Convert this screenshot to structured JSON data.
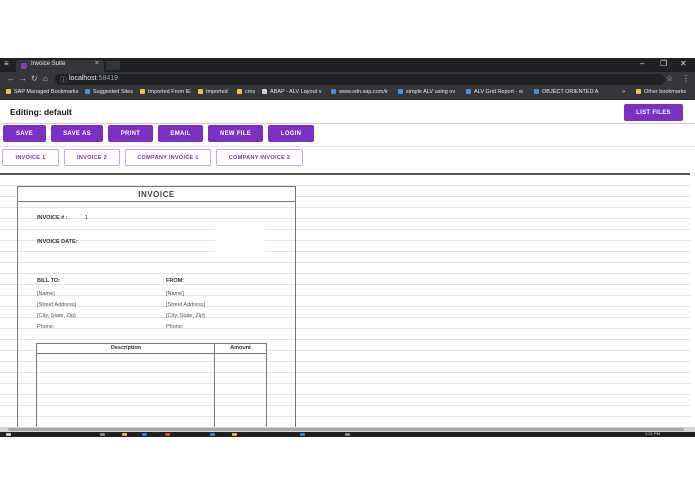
{
  "browser": {
    "tab_title": "Invoice Suite",
    "tab_close": "×",
    "url_host": "localhost",
    "url_port": ":58419",
    "bookmarks": [
      {
        "label": "SAP Managed Bookmarks",
        "color": "#f0c04a"
      },
      {
        "label": "Suggested Sites",
        "color": "#4a90d9"
      },
      {
        "label": "Imported From IE",
        "color": "#f0c04a"
      },
      {
        "label": "Imported",
        "color": "#f0c04a"
      },
      {
        "label": "cms",
        "color": "#f0c04a"
      },
      {
        "label": "ABAP - ALV Layout v",
        "color": "#cfcfcf"
      },
      {
        "label": "www.sdn.sap.com/ir",
        "color": "#4a90d9"
      },
      {
        "label": "simple ALV using ov",
        "color": "#4a90d9"
      },
      {
        "label": "ALV Grid Report - w",
        "color": "#4a90d9"
      },
      {
        "label": "OBJECT ORIENTED A",
        "color": "#4a90d9"
      }
    ],
    "bookmarks_overflow": "»",
    "other_bookmarks": "Other bookmarks"
  },
  "app": {
    "editing_title": "Editing: default",
    "list_files_label": "LIST FILES",
    "actions": [
      "SAVE",
      "SAVE AS",
      "PRINT",
      "EMAIL",
      "NEW FILE",
      "LOGIN"
    ],
    "invoice_tabs": [
      "INVOICE 1",
      "INVOICE 2",
      "COMPANY INVOICE 1",
      "COMPANY INVOICE 2"
    ],
    "accent_color": "#7b2fc4"
  },
  "invoice": {
    "header": "INVOICE",
    "number_label": "INVOICE # :",
    "number_value": "1",
    "date_label": "INVOICE DATE:",
    "bill_to": {
      "label": "BILL TO:",
      "name": "[Name]",
      "street": "[Street Address]",
      "city": "[City, State, Zip]",
      "phone": "Phone:"
    },
    "from": {
      "label": "FROM:",
      "name": "[Name]",
      "street": "[Street Address]",
      "city": "[City, State, Zip]",
      "phone": "Phone:"
    },
    "columns": {
      "description": "Description",
      "amount": "Amount"
    }
  },
  "system": {
    "clock": "1:21 PM"
  }
}
